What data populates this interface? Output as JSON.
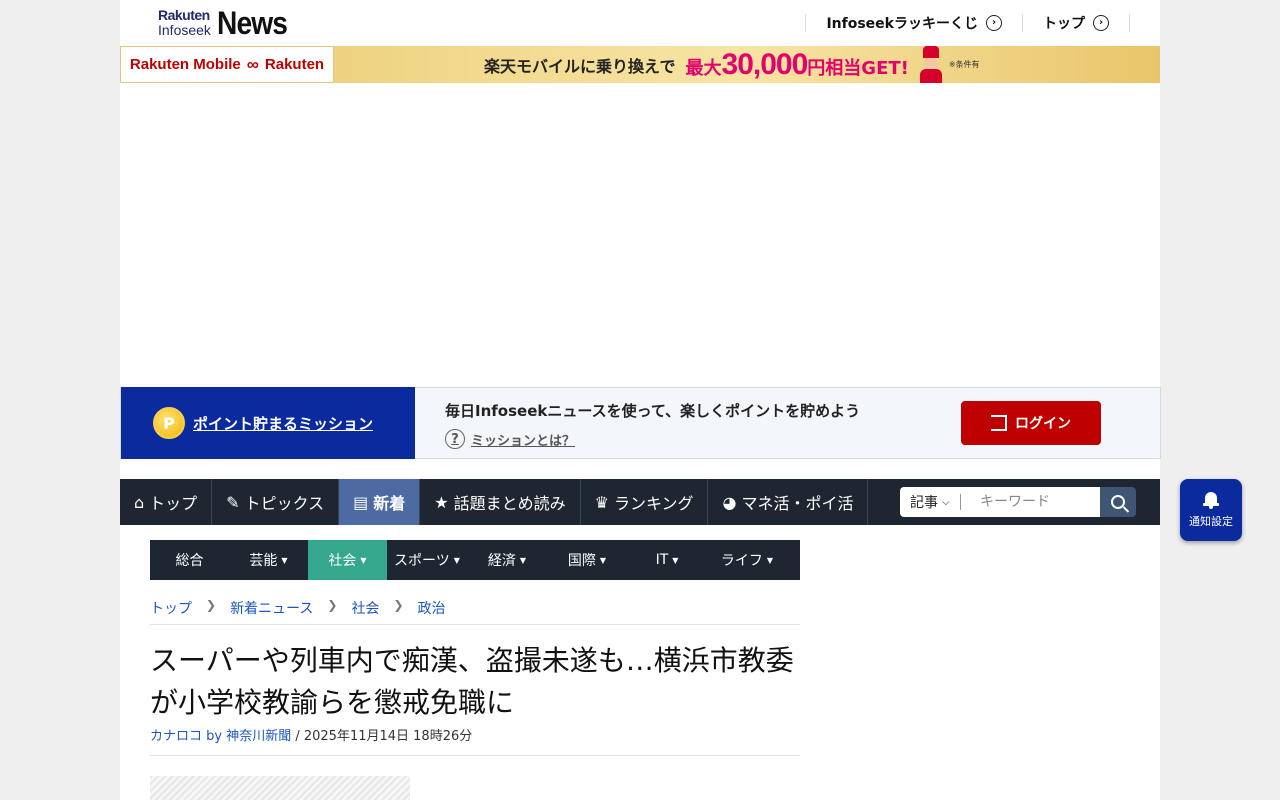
{
  "header": {
    "logo_rakuten": "Rakuten",
    "logo_infoseek": "Infoseek",
    "logo_news": "News",
    "links": [
      "Infoseekラッキーくじ",
      "トップ"
    ]
  },
  "banner": {
    "brand": "Rakuten Mobile",
    "brand2": "Rakuten",
    "copy": "楽天モバイルに乗り換えで",
    "prefix": "最大",
    "amount": "30,000",
    "suffix": "円相当GET!",
    "note": "※条件有"
  },
  "mission": {
    "link": "ポイント貯まるミッション",
    "coin": "P",
    "headline": "毎日Infoseekニュースを使って、楽しくポイントを貯めよう",
    "help": "ミッションとは？",
    "login": "ログイン"
  },
  "nav": {
    "items": [
      {
        "icon": "home-icon",
        "glyph": "⌂",
        "label": "トップ"
      },
      {
        "icon": "pencil-icon",
        "glyph": "✎",
        "label": "トピックス"
      },
      {
        "icon": "document-icon",
        "glyph": "▤",
        "label": "新着"
      },
      {
        "icon": "star-icon",
        "glyph": "★",
        "label": "話題まとめ読み"
      },
      {
        "icon": "crown-icon",
        "glyph": "♛",
        "label": "ランキング"
      },
      {
        "icon": "money-bag-icon",
        "glyph": "◕",
        "label": "マネ活・ポイ活"
      }
    ],
    "active_index": 2
  },
  "search": {
    "scope": "記事",
    "placeholder": "キーワード"
  },
  "subnav": {
    "items": [
      "総合",
      "芸能",
      "社会",
      "スポーツ",
      "経済",
      "国際",
      "IT",
      "ライフ"
    ],
    "active_index": 2
  },
  "breadcrumb": [
    "トップ",
    "新着ニュース",
    "社会",
    "政治"
  ],
  "article": {
    "title": "スーパーや列車内で痴漢、盗撮未遂も…横浜市教委が小学校教諭らを懲戒免職に",
    "source": "カナロコ by 神奈川新聞",
    "date": " / 2025年11月14日 18時26分"
  },
  "notify": {
    "label": "通知設定"
  },
  "colors": {
    "rakuten_red": "#bf0000",
    "mission_blue": "#0a2a9e",
    "nav_bg": "#1e2731",
    "nav_active": "#4d6aa3",
    "subnav_active": "#34a78c",
    "link_blue": "#1a56c2"
  }
}
